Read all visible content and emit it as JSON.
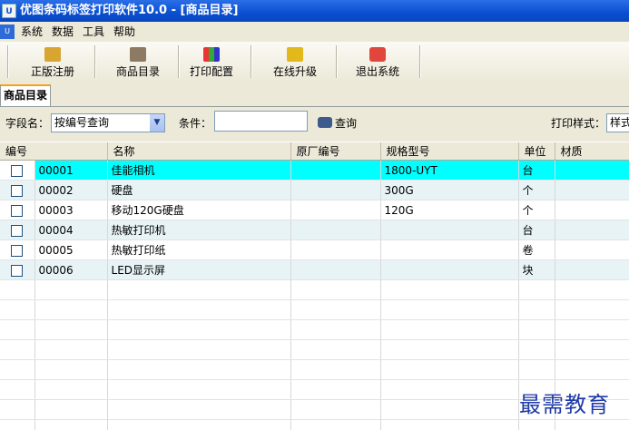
{
  "window": {
    "icon": "U",
    "title": "优图条码标签打印软件10.0 - [商品目录]"
  },
  "menu": {
    "icon": "U",
    "items": [
      "系统",
      "数据",
      "工具",
      "帮助"
    ]
  },
  "toolbar": {
    "register": "正版注册",
    "catalog": "商品目录",
    "print_config": "打印配置",
    "upgrade": "在线升级",
    "exit": "退出系统"
  },
  "tabs": {
    "active": "商品目录"
  },
  "filter": {
    "field_label": "字段名：",
    "field_value": "按编号查询",
    "condition_label": "条件：",
    "condition_value": "",
    "query_label": "查询",
    "print_style_label": "打印样式：",
    "print_style_value": "样式"
  },
  "grid": {
    "columns": [
      "编号",
      "名称",
      "原厂编号",
      "规格型号",
      "单位",
      "材质"
    ],
    "rows": [
      {
        "code": "00001",
        "name": "佳能相机",
        "oem": "",
        "spec": "1800-UYT",
        "unit": "台",
        "material": "",
        "selected": true
      },
      {
        "code": "00002",
        "name": "硬盘",
        "oem": "",
        "spec": "300G",
        "unit": "个",
        "material": "",
        "selected": false
      },
      {
        "code": "00003",
        "name": "移动120G硬盘",
        "oem": "",
        "spec": "120G",
        "unit": "个",
        "material": "",
        "selected": false
      },
      {
        "code": "00004",
        "name": "热敏打印机",
        "oem": "",
        "spec": "",
        "unit": "台",
        "material": "",
        "selected": false
      },
      {
        "code": "00005",
        "name": "热敏打印纸",
        "oem": "",
        "spec": "",
        "unit": "卷",
        "material": "",
        "selected": false
      },
      {
        "code": "00006",
        "name": "LED显示屏",
        "oem": "",
        "spec": "",
        "unit": "块",
        "material": "",
        "selected": false
      }
    ]
  },
  "watermark": "最需教育",
  "colors": {
    "titlebar": "#0a4fd0",
    "selected_row": "#00ffff",
    "alt_row": "#e8f3f6",
    "tab_accent": "#f2a21b"
  }
}
